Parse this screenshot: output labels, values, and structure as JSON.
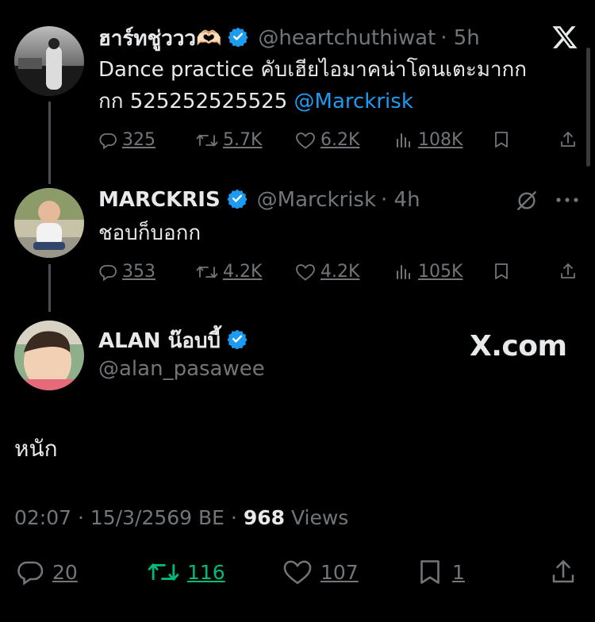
{
  "tweets": [
    {
      "name": "ฮาร์ทชู่ววว🫶🏻",
      "handle": "@heartchuthiwat",
      "time": "· 5h",
      "text": "Dance practice คับเฮียไอมาคน่าโดนเตะมากก",
      "text_line2": "กก 525252525525 ",
      "mention": "@Marckrisk",
      "replies": "325",
      "reposts": "5.7K",
      "likes": "6.2K",
      "views": "108K"
    },
    {
      "name": "MARCKRIS",
      "handle": "@Marckrisk",
      "time": "· 4h",
      "text": "ชอบก็บอกก",
      "replies": "353",
      "reposts": "4.2K",
      "likes": "4.2K",
      "views": "105K"
    }
  ],
  "main": {
    "name": "ALAN น๊อบบี้",
    "handle": "@alan_pasawee",
    "text": "หนัก",
    "meta_time": "02:07 · 15/3/2569 BE · ",
    "views_count": "968",
    "views_label": " Views",
    "replies": "20",
    "reposts": "116",
    "likes": "107",
    "bookmarks": "1"
  },
  "watermark": "X.com",
  "icons": [
    "x-logo-icon",
    "verified-icon",
    "reply-icon",
    "repost-icon",
    "like-icon",
    "views-icon",
    "bookmark-icon",
    "share-icon",
    "grok-icon",
    "more-icon"
  ],
  "colors": {
    "background": "#000000",
    "accent": "#1d9bf0",
    "muted": "#71767b",
    "repost_active": "#00ba7c"
  }
}
